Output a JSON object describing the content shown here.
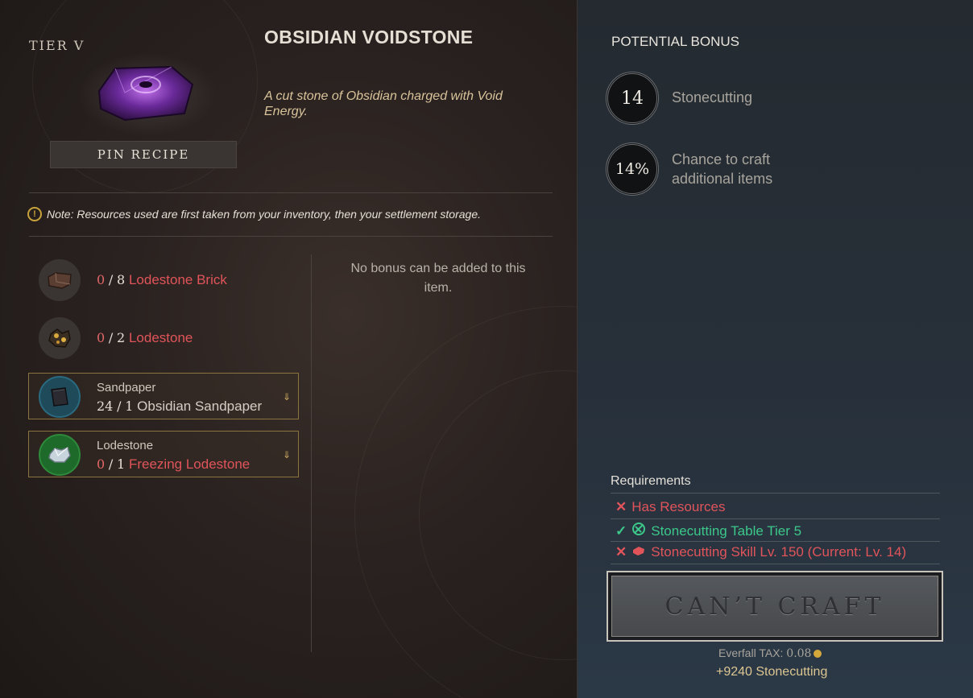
{
  "item": {
    "tier_label": "TIER V",
    "title": "OBSIDIAN VOIDSTONE",
    "description": "A cut stone of Obsidian charged with Void Energy.",
    "pin_label": "PIN RECIPE"
  },
  "note": {
    "icon": "!",
    "text": "Note: Resources used are first taken from your inventory, then your settlement storage."
  },
  "resources": [
    {
      "have": "0",
      "sep": "/",
      "need": "8",
      "name": "Lodestone Brick",
      "icon": "lodestone-brick-icon"
    },
    {
      "have": "0",
      "sep": "/",
      "need": "2",
      "name": "Lodestone",
      "icon": "lodestone-icon"
    }
  ],
  "selectable_resources": [
    {
      "category": "Sandpaper",
      "have": "24",
      "sep": "/",
      "need": "1",
      "name": "Obsidian Sandpaper",
      "icon": "obsidian-sandpaper-icon",
      "arrow": "⇓"
    },
    {
      "category": "Lodestone",
      "have": "0",
      "sep": "/",
      "need": "1",
      "name": "Freezing Lodestone",
      "icon": "freezing-lodestone-icon",
      "arrow": "⇓"
    }
  ],
  "bonus_note": "No bonus can be added to this item.",
  "potential_bonus": {
    "title": "POTENTIAL BONUS",
    "skill_value": "14",
    "skill_label": "Stonecutting",
    "chance_value": "14%",
    "chance_label_1": "Chance to craft",
    "chance_label_2": "additional items"
  },
  "requirements": {
    "title": "Requirements",
    "items": [
      {
        "status": "✕",
        "text": "Has Resources",
        "met": false
      },
      {
        "status": "✓",
        "text": "Stonecutting Table Tier 5",
        "met": true
      },
      {
        "status": "✕",
        "text": "Stonecutting Skill Lv. 150 (Current: Lv. 14)",
        "met": false
      }
    ]
  },
  "craft": {
    "button_label": "CAN’T CRAFT",
    "tax_label": "Everfall TAX:",
    "tax_value": "0.08",
    "xp_text": "+9240 Stonecutting"
  },
  "colors": {
    "missing": "#e0545a",
    "met": "#3cc88a",
    "accent_gold": "#c8a23a"
  }
}
